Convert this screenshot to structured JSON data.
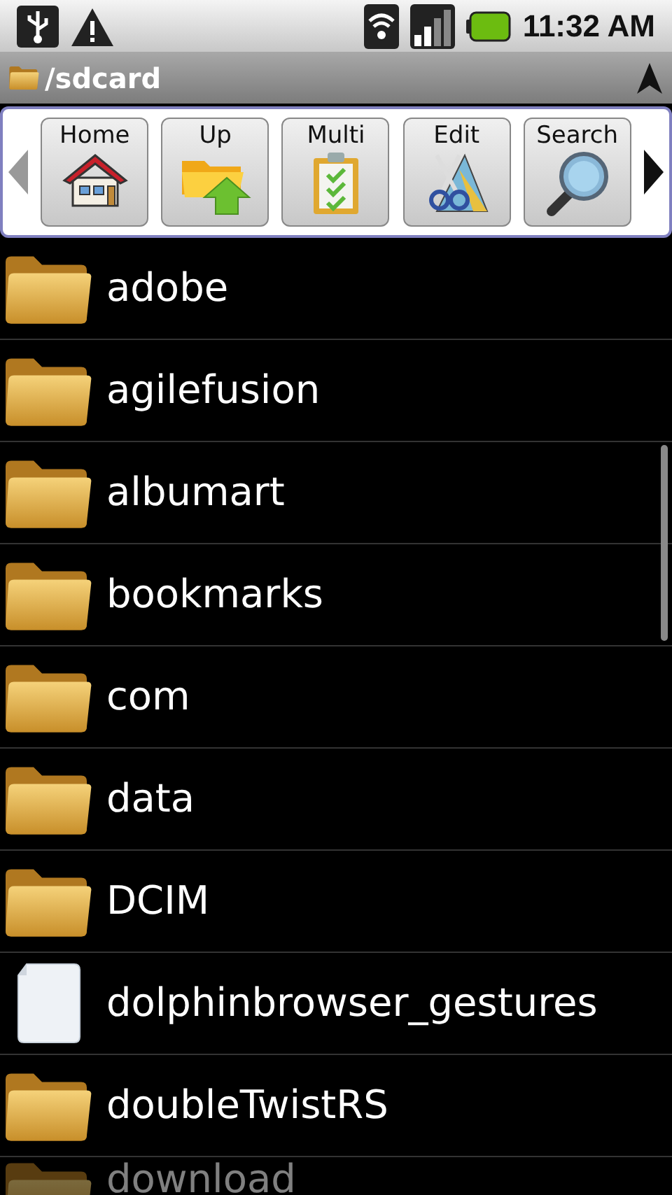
{
  "status_bar": {
    "time": "11:32 AM"
  },
  "path_bar": {
    "path": "/sdcard"
  },
  "toolbar": {
    "buttons": [
      {
        "label": "Home"
      },
      {
        "label": "Up"
      },
      {
        "label": "Multi"
      },
      {
        "label": "Edit"
      },
      {
        "label": "Search"
      }
    ]
  },
  "files": [
    {
      "name": "adobe",
      "kind": "folder"
    },
    {
      "name": "agilefusion",
      "kind": "folder"
    },
    {
      "name": "albumart",
      "kind": "folder"
    },
    {
      "name": "bookmarks",
      "kind": "folder"
    },
    {
      "name": "com",
      "kind": "folder"
    },
    {
      "name": "data",
      "kind": "folder"
    },
    {
      "name": "DCIM",
      "kind": "folder"
    },
    {
      "name": "dolphinbrowser_gestures",
      "kind": "file"
    },
    {
      "name": "doubleTwistRS",
      "kind": "folder"
    },
    {
      "name": "download",
      "kind": "folder"
    }
  ]
}
